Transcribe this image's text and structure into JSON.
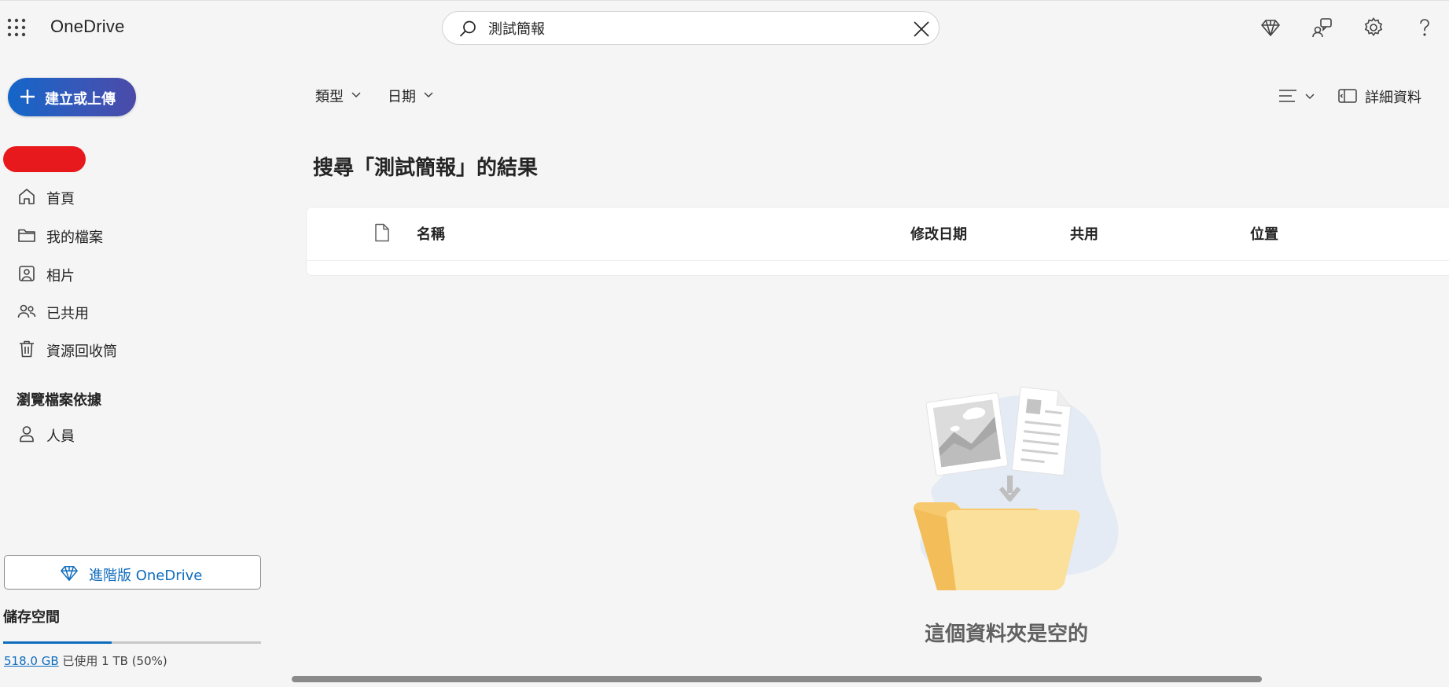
{
  "app": {
    "title": "OneDrive"
  },
  "search": {
    "value": "測試簡報",
    "placeholder": ""
  },
  "top_icons": [
    "waffle-icon",
    "diamond-icon",
    "feedback-icon",
    "gear-icon",
    "help-icon"
  ],
  "sidebar": {
    "create_label": "建立或上傳",
    "items": [
      {
        "label": "首頁",
        "icon": "home-icon"
      },
      {
        "label": "我的檔案",
        "icon": "folder-icon"
      },
      {
        "label": "相片",
        "icon": "photo-icon"
      },
      {
        "label": "已共用",
        "icon": "people-icon"
      },
      {
        "label": "資源回收筒",
        "icon": "trash-icon"
      }
    ],
    "browse_section": "瀏覽檔案依據",
    "browse_items": [
      {
        "label": "人員",
        "icon": "person-icon"
      }
    ],
    "premium_label": "進階版 OneDrive",
    "storage": {
      "title": "儲存空間",
      "used": "518.0 GB",
      "rest": " 已使用 1 TB (50%)",
      "fraction": 0.5
    }
  },
  "filters": {
    "type_label": "類型",
    "date_label": "日期"
  },
  "toolbar": {
    "details_label": "詳細資料"
  },
  "main": {
    "results_title": "搜尋「測試簡報」的結果",
    "columns": [
      "名稱",
      "修改日期",
      "共用",
      "位置"
    ],
    "empty_text": "這個資料夾是空的"
  },
  "colors": {
    "accent": "#0f6cbd",
    "create_gradient_start": "#1366c9",
    "create_gradient_end": "#4b4aa8"
  }
}
